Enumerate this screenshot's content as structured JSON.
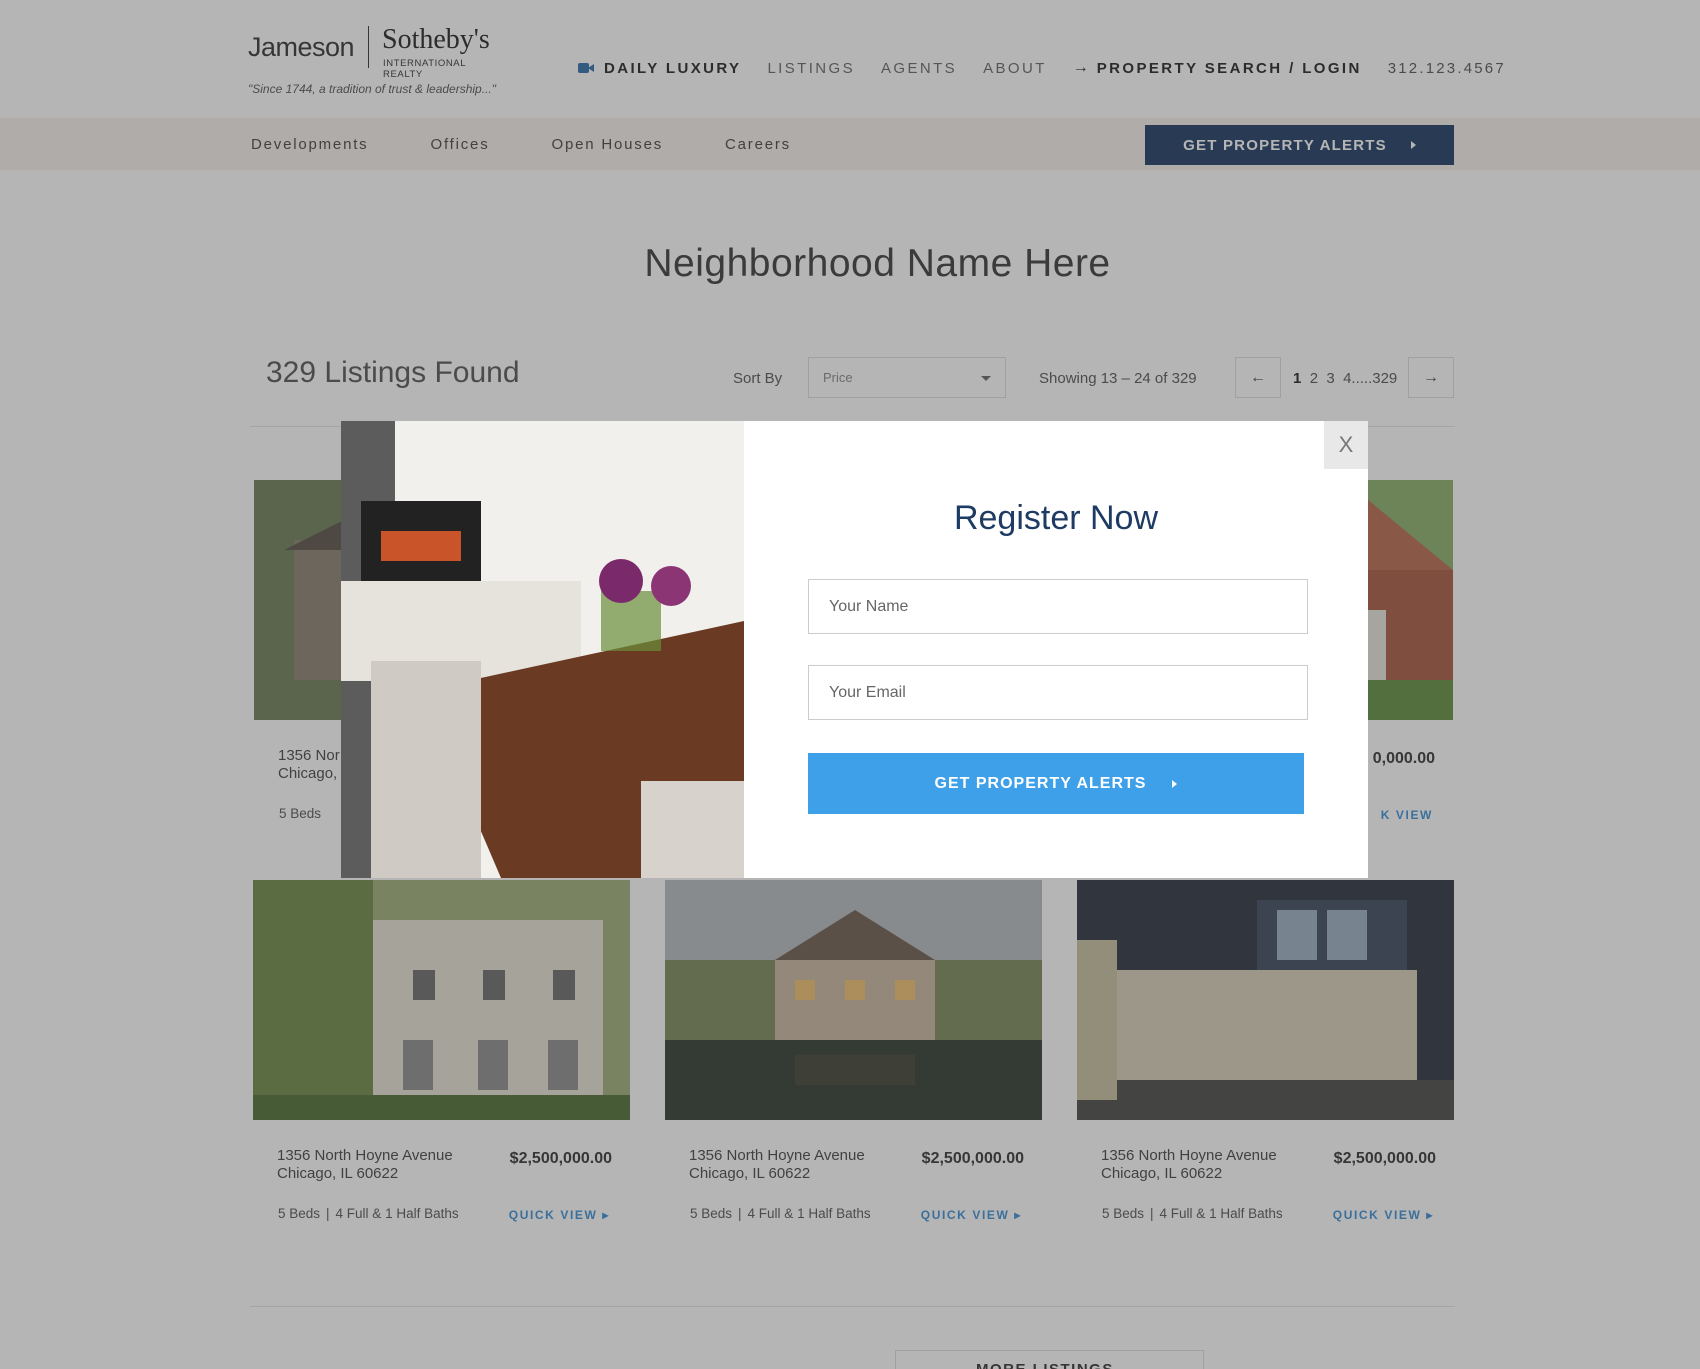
{
  "header": {
    "logo_left": "Jameson",
    "logo_right": "Sotheby's",
    "logo_sub": "INTERNATIONAL REALTY",
    "tagline": "\"Since 1744, a tradition of trust & leadership...\"",
    "nav": {
      "daily_luxury": "DAILY LUXURY",
      "listings": "LISTINGS",
      "agents": "AGENTS",
      "about": "ABOUT",
      "search_login": "PROPERTY SEARCH / LOGIN",
      "phone": "312.123.4567"
    },
    "subnav": [
      "Developments",
      "Offices",
      "Open Houses",
      "Careers"
    ],
    "alert_button": "GET PROPERTY ALERTS"
  },
  "main": {
    "title": "Neighborhood Name Here",
    "listings_found": "329 Listings Found",
    "sort_label": "Sort By",
    "sort_value": "Price",
    "showing": "Showing 13 – 24 of 329",
    "pages": {
      "p1": "1",
      "p2": "2",
      "p3": "3",
      "p4": "4.....329"
    },
    "prev": "←",
    "next": "→"
  },
  "cards": [
    {
      "address1": "1356 North Hoyne Avenue",
      "address2": "Chicago, IL 60622",
      "price": "$2,500,000.00",
      "beds": "5 Beds",
      "baths": "4 Full & 1 Half Baths",
      "quick_view": "QUICK VIEW"
    },
    {
      "address1": "1356 North Hoyne Avenue",
      "address2": "Chicago, IL 60622",
      "price": "$2,500,000.00",
      "beds": "5 Beds",
      "baths": "4 Full & 1 Half Baths",
      "quick_view": "QUICK VIEW"
    },
    {
      "address1": "1356 North Hoyne Avenue",
      "address2": "Chicago, IL 60622",
      "price": "$2,500,000.00",
      "beds": "5 Beds",
      "baths": "4 Full & 1 Half Baths",
      "quick_view": "QUICK VIEW"
    }
  ],
  "top_row_partial": {
    "address1": "1356 Nor",
    "address2": "Chicago,",
    "beds": "5 Beds",
    "price_right": "0,000.00",
    "quick_view_right": "K VIEW"
  },
  "bottom_partial": {
    "more_listings": "MORE LISTINGS"
  },
  "modal": {
    "title": "Register Now",
    "name_placeholder": "Your Name",
    "email_placeholder": "Your Email",
    "submit": "GET PROPERTY ALERTS",
    "close": "X"
  },
  "colors": {
    "navy": "#1d3b63",
    "blue": "#3fa0ea",
    "link_blue": "#3b8fd6"
  }
}
